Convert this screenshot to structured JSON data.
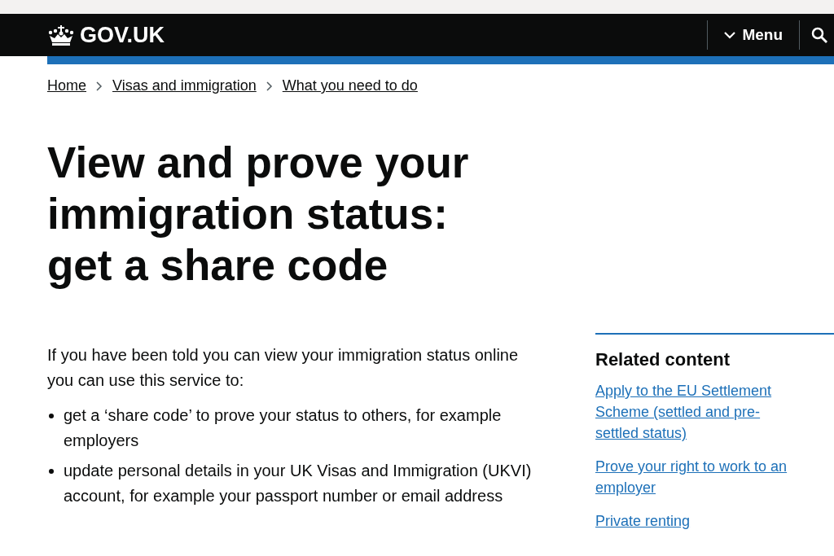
{
  "header": {
    "logo": "GOV.UK",
    "menu": "Menu"
  },
  "breadcrumbs": [
    "Home",
    "Visas and immigration",
    "What you need to do"
  ],
  "title": "View and prove your immigration status: get a share code",
  "intro": "If you have been told you can view your immigration status online you can use this service to:",
  "bullets": [
    "get a ‘share code’ to prove your status to others, for example employers",
    "update personal details in your UK Visas and Immigration (UKVI) account, for example your passport number or email address"
  ],
  "related": {
    "heading": "Related content",
    "links": [
      "Apply to the EU Settlement Scheme (settled and pre-settled status)",
      "Prove your right to work to an employer",
      "Private renting"
    ]
  }
}
